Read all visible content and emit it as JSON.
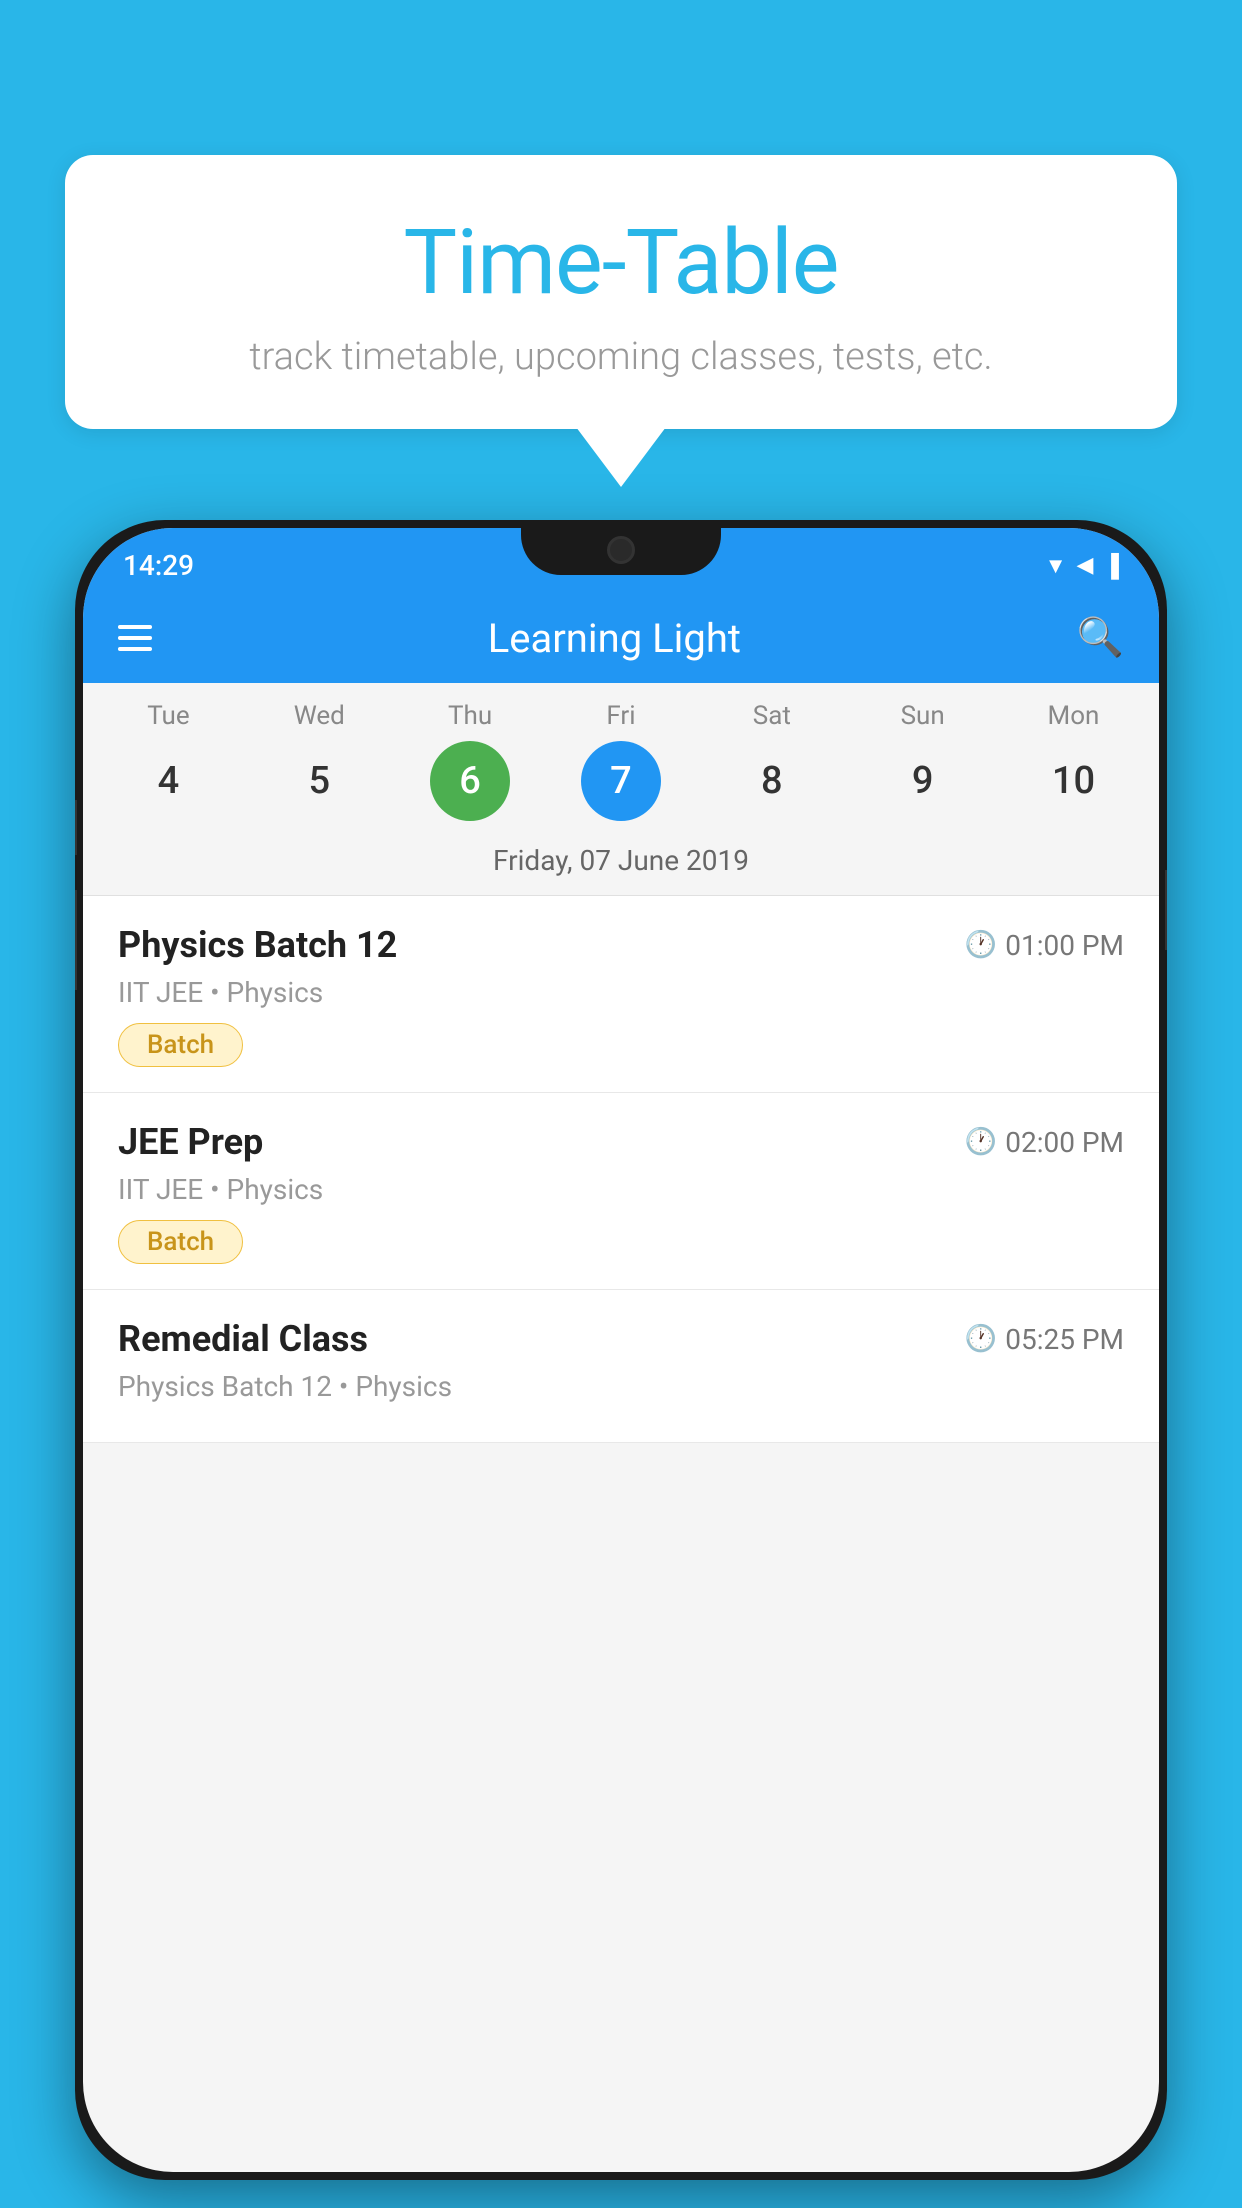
{
  "background_color": "#29b6e8",
  "speech_bubble": {
    "title": "Time-Table",
    "subtitle": "track timetable, upcoming classes, tests, etc."
  },
  "phone": {
    "status_bar": {
      "time": "14:29",
      "wifi": "▲",
      "signal": "▲",
      "battery": "▮"
    },
    "header": {
      "title": "Learning Light",
      "menu_icon": "menu",
      "search_icon": "search"
    },
    "calendar": {
      "days": [
        {
          "label": "Tue",
          "number": "4"
        },
        {
          "label": "Wed",
          "number": "5"
        },
        {
          "label": "Thu",
          "number": "6",
          "state": "today"
        },
        {
          "label": "Fri",
          "number": "7",
          "state": "selected"
        },
        {
          "label": "Sat",
          "number": "8"
        },
        {
          "label": "Sun",
          "number": "9"
        },
        {
          "label": "Mon",
          "number": "10"
        }
      ],
      "selected_date": "Friday, 07 June 2019"
    },
    "schedule": {
      "items": [
        {
          "name": "Physics Batch 12",
          "time": "01:00 PM",
          "subtitle": "IIT JEE • Physics",
          "tag": "Batch"
        },
        {
          "name": "JEE Prep",
          "time": "02:00 PM",
          "subtitle": "IIT JEE • Physics",
          "tag": "Batch"
        },
        {
          "name": "Remedial Class",
          "time": "05:25 PM",
          "subtitle": "Physics Batch 12 • Physics",
          "tag": ""
        }
      ]
    }
  }
}
